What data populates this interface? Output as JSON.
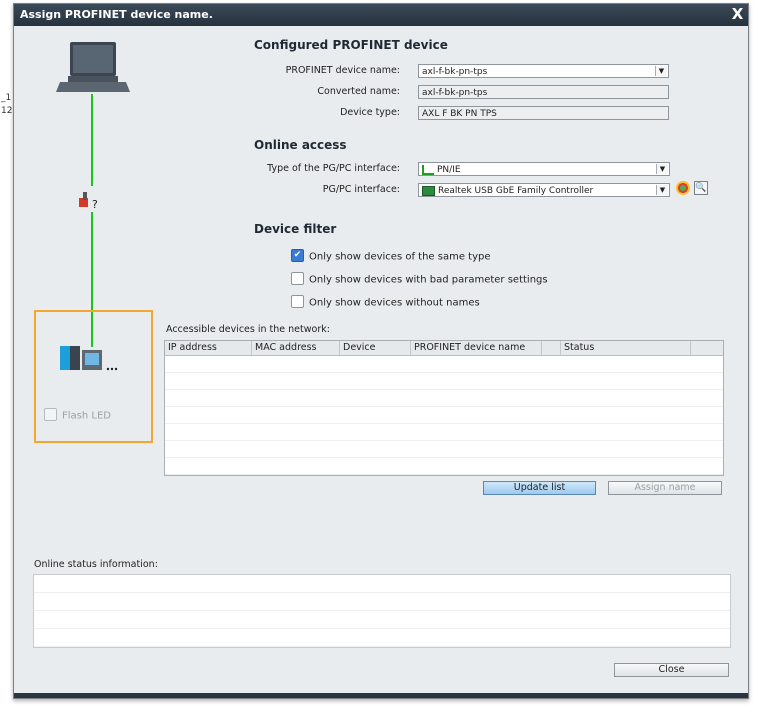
{
  "background_fragments": [
    "_1",
    "12"
  ],
  "dialog": {
    "title": "Assign PROFINET device name.",
    "close_glyph": "X"
  },
  "configured": {
    "heading": "Configured PROFINET device",
    "device_name_label": "PROFINET device name:",
    "device_name_value": "axl-f-bk-pn-tps",
    "converted_name_label": "Converted name:",
    "converted_name_value": "axl-f-bk-pn-tps",
    "device_type_label": "Device type:",
    "device_type_value": "AXL F BK PN TPS"
  },
  "online_access": {
    "heading": "Online access",
    "interface_type_label": "Type of the PG/PC interface:",
    "interface_type_value": "PN/IE",
    "interface_label": "PG/PC interface:",
    "interface_value": "Realtek USB GbE Family Controller"
  },
  "device_filter": {
    "heading": "Device filter",
    "options": [
      {
        "label": "Only show devices of the same type",
        "checked": true
      },
      {
        "label": "Only show devices with bad parameter settings",
        "checked": false
      },
      {
        "label": "Only show devices without names",
        "checked": false
      }
    ]
  },
  "flash_led_label": "Flash LED",
  "network": {
    "label": "Accessible devices in the network:",
    "columns": [
      "IP address",
      "MAC address",
      "Device",
      "PROFINET device name",
      "Status"
    ]
  },
  "buttons": {
    "update_list": "Update list",
    "assign_name": "Assign name",
    "close": "Close"
  },
  "online_status_label": "Online status information:",
  "colors": {
    "link_line": "#1ec41e",
    "highlight_box": "#f2a72e",
    "title_bar": "#2f3c49"
  }
}
